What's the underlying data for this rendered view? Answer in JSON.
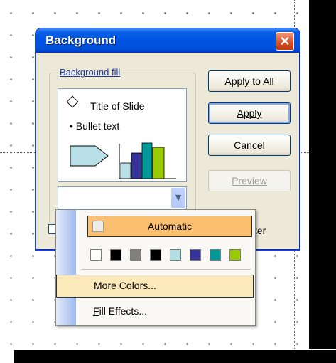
{
  "dialog": {
    "title": "Background",
    "close_glyph": "✕",
    "group_label": "Background fill",
    "preview": {
      "slide_title": "Title of Slide",
      "bullet_text": "• Bullet text"
    },
    "buttons": {
      "apply_to_all": "Apply to All",
      "apply": "Apply",
      "cancel": "Cancel",
      "preview": "Preview"
    },
    "omit_checkbox_label_visible": "ster"
  },
  "menu": {
    "automatic_label": "Automatic",
    "more_colors_label": "More Colors...",
    "fill_effects_label": "Fill Effects...",
    "swatch_colors": [
      "#ffffff",
      "#000000",
      "#808080",
      "#000000",
      "#b0dfe4",
      "#333399",
      "#009999",
      "#99cc00"
    ]
  },
  "colors": {
    "titlebar": "#0054e3",
    "dialog_bg": "#ece9d8",
    "menu_highlight": "#fbc06f",
    "menu_hover": "#fce9ba"
  }
}
